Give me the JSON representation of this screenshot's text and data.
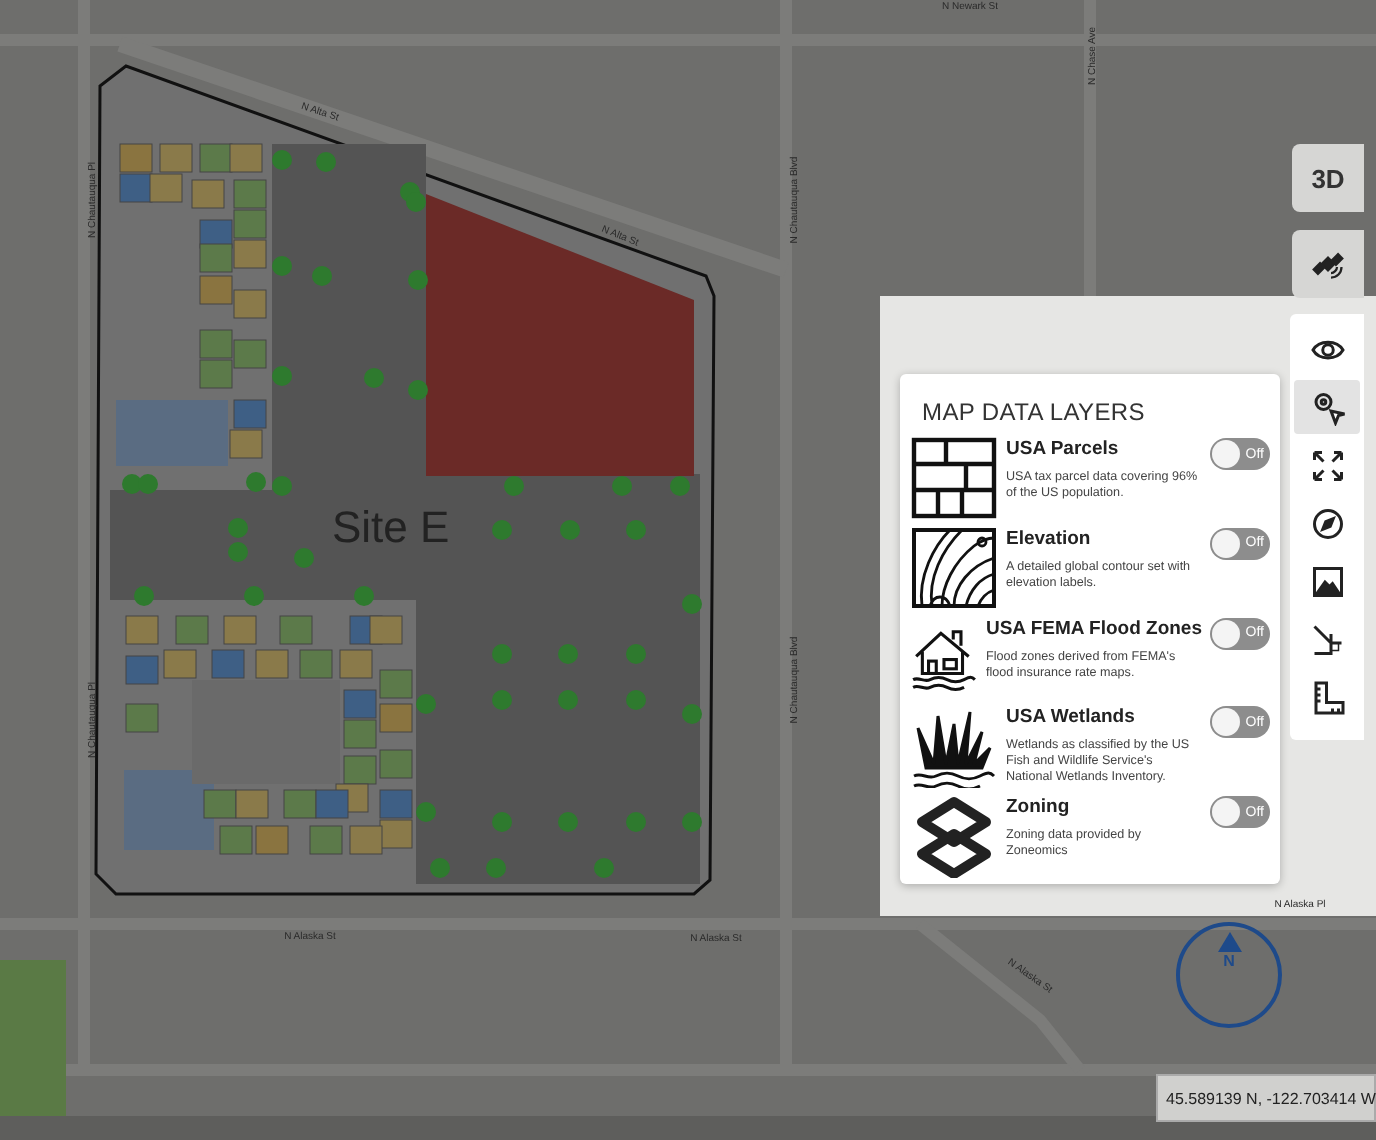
{
  "map": {
    "site_label": "Site E",
    "street_labels": [
      {
        "kind": "along",
        "text": "N Alta St"
      },
      {
        "kind": "along",
        "text": "N Alta St"
      },
      {
        "kind": "vertical",
        "text": "N Chautauqua Pl"
      },
      {
        "kind": "vertical",
        "text": "N Chautauqua Pl"
      },
      {
        "kind": "vertical",
        "text": "N Chautauqua Blvd"
      },
      {
        "kind": "vertical",
        "text": "N Chautauqua Blvd"
      },
      {
        "kind": "along",
        "text": "N Alaska St"
      },
      {
        "kind": "along",
        "text": "N Alaska St"
      },
      {
        "kind": "vertical",
        "text": "N Chase Ave"
      },
      {
        "kind": "along",
        "text": "N Newark St"
      },
      {
        "kind": "along",
        "text": "N Alaska Pl"
      },
      {
        "kind": "along",
        "text": "N Alaska St"
      }
    ]
  },
  "view_buttons": [
    {
      "kind": "text",
      "label": "3D"
    },
    {
      "kind": "satellite"
    }
  ],
  "layers_panel": {
    "title": "MAP DATA LAYERS",
    "layers": [
      {
        "kind": "parcels",
        "name": "USA Parcels",
        "description": "USA tax parcel data covering 96% of the US population.",
        "toggle_label": "Off",
        "on": false
      },
      {
        "kind": "elevation",
        "name": "Elevation",
        "description": "A detailed global contour set with elevation labels.",
        "toggle_label": "Off",
        "on": false
      },
      {
        "kind": "flood",
        "name": "USA FEMA Flood Zones",
        "description": "Flood zones derived from FEMA's flood insurance rate maps.",
        "toggle_label": "Off",
        "on": false
      },
      {
        "kind": "wetlands",
        "name": "USA Wetlands",
        "description": "Wetlands as classified by the US Fish and Wildlife Service's National Wetlands Inventory.",
        "toggle_label": "Off",
        "on": false
      },
      {
        "kind": "zoning",
        "name": "Zoning",
        "description": "Zoning data provided by Zoneomics",
        "toggle_label": "Off",
        "on": false
      }
    ]
  },
  "toolbar": {
    "tools": [
      {
        "kind": "eye",
        "selected": false
      },
      {
        "kind": "layers",
        "selected": true
      },
      {
        "kind": "expand",
        "selected": false
      },
      {
        "kind": "compass",
        "selected": false
      },
      {
        "kind": "image",
        "selected": false
      },
      {
        "kind": "measure",
        "selected": false
      },
      {
        "kind": "ruler",
        "selected": false
      }
    ]
  },
  "compass": {
    "label": "N"
  },
  "coordinates": "45.589139 N, -122.703414 W"
}
